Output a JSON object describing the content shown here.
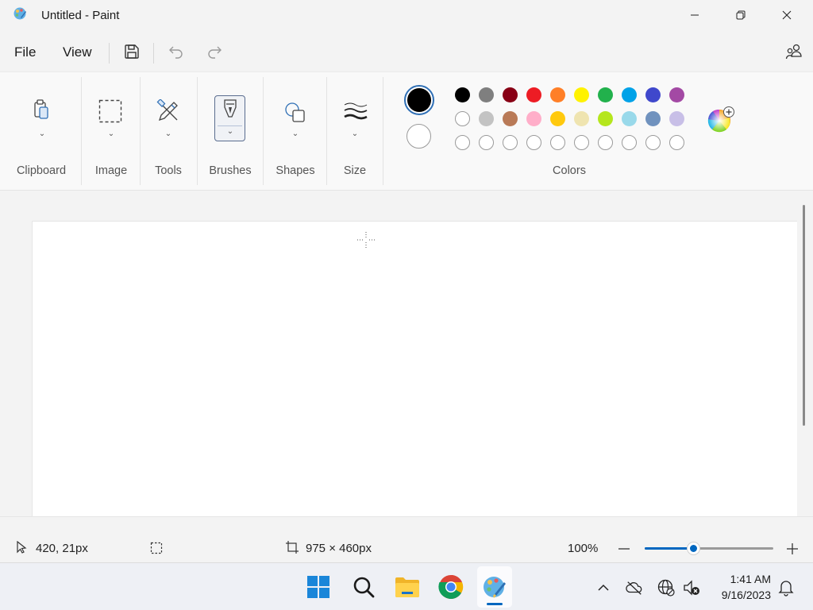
{
  "window": {
    "title": "Untitled - Paint"
  },
  "menu": {
    "file": "File",
    "view": "View"
  },
  "ribbon": {
    "groups": [
      "Clipboard",
      "Image",
      "Tools",
      "Brushes",
      "Shapes",
      "Size",
      "Colors"
    ]
  },
  "colors": {
    "primary": "#000000",
    "secondary": "#ffffff",
    "row1": [
      "#000000",
      "#7f7f7f",
      "#880015",
      "#ed1c24",
      "#ff7f27",
      "#fff200",
      "#22b14c",
      "#00a2e8",
      "#3f48cc",
      "#a349a4"
    ],
    "row2": [
      "#ffffff",
      "#c3c3c3",
      "#b97a57",
      "#ffaec9",
      "#ffc90e",
      "#efe4b0",
      "#b5e61d",
      "#99d9ea",
      "#7092be",
      "#c8bfe7"
    ],
    "row3_empty_count": 10
  },
  "status": {
    "cursor_position": "420, 21px",
    "canvas_size": "975 × 460px",
    "zoom": "100%",
    "zoom_fraction": 0.38
  },
  "taskbar": {
    "apps": [
      "start-icon",
      "search-icon",
      "file-explorer-icon",
      "chrome-icon",
      "paint-icon"
    ],
    "time": "1:41 AM",
    "date": "9/16/2023"
  }
}
